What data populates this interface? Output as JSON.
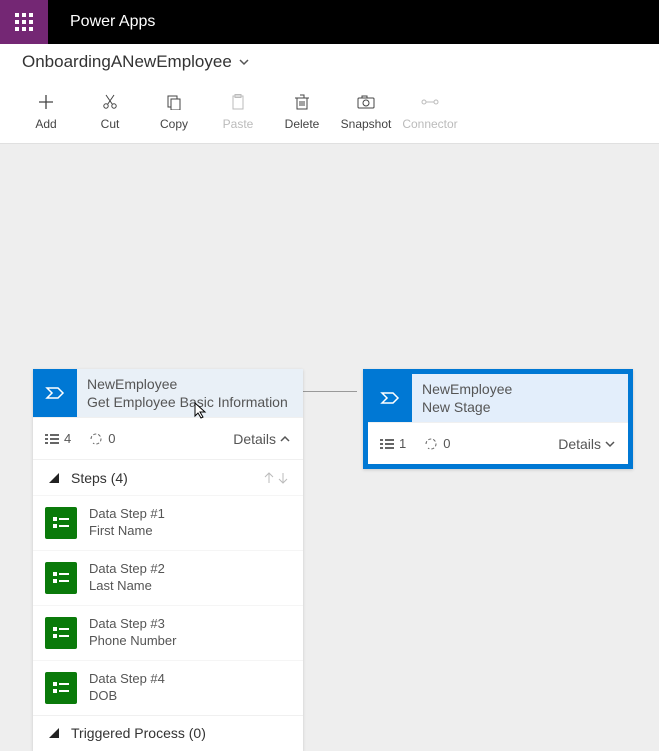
{
  "header": {
    "app_name": "Power Apps"
  },
  "breadcrumb": {
    "title": "OnboardingANewEmployee"
  },
  "toolbar": {
    "add": "Add",
    "cut": "Cut",
    "copy": "Copy",
    "paste": "Paste",
    "delete": "Delete",
    "snapshot": "Snapshot",
    "connector": "Connector"
  },
  "stage1": {
    "title": "NewEmployee",
    "subtitle": "Get Employee Basic Information",
    "steps_count": "4",
    "process_count": "0",
    "details_label": "Details",
    "steps_header": "Steps (4)",
    "steps": [
      {
        "name": "Data Step #1",
        "field": "First Name"
      },
      {
        "name": "Data Step #2",
        "field": "Last Name"
      },
      {
        "name": "Data Step #3",
        "field": "Phone Number"
      },
      {
        "name": "Data Step #4",
        "field": "DOB"
      }
    ],
    "triggered_header": "Triggered Process (0)"
  },
  "stage2": {
    "title": "NewEmployee",
    "subtitle": "New Stage",
    "steps_count": "1",
    "process_count": "0",
    "details_label": "Details"
  }
}
